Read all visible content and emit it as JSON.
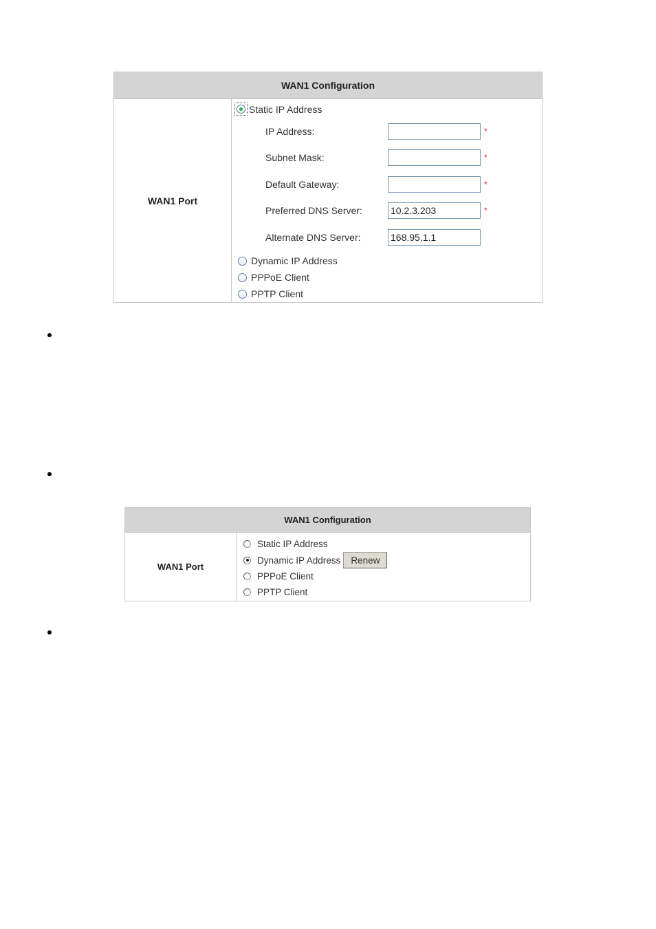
{
  "panel1": {
    "title": "WAN1 Configuration",
    "port_label": "WAN1 Port",
    "selected_mode": "Static IP Address",
    "modes": [
      "Static IP Address",
      "Dynamic IP Address",
      "PPPoE Client",
      "PPTP Client"
    ],
    "fields": [
      {
        "label": "IP Address:",
        "value": "",
        "required": true
      },
      {
        "label": "Subnet Mask:",
        "value": "",
        "required": true
      },
      {
        "label": "Default Gateway:",
        "value": "",
        "required": true
      },
      {
        "label": "Preferred DNS Server:",
        "value": "10.2.3.203",
        "required": true
      },
      {
        "label": "Alternate DNS Server:",
        "value": "168.95.1.1",
        "required": false
      }
    ],
    "required_mark": "*"
  },
  "panel2": {
    "title": "WAN1 Configuration",
    "port_label": "WAN1 Port",
    "selected_mode": "Dynamic IP Address",
    "modes": [
      "Static IP Address",
      "Dynamic IP Address",
      "PPPoE Client",
      "PPTP Client"
    ],
    "renew_label": "Renew"
  },
  "bullets": 3
}
